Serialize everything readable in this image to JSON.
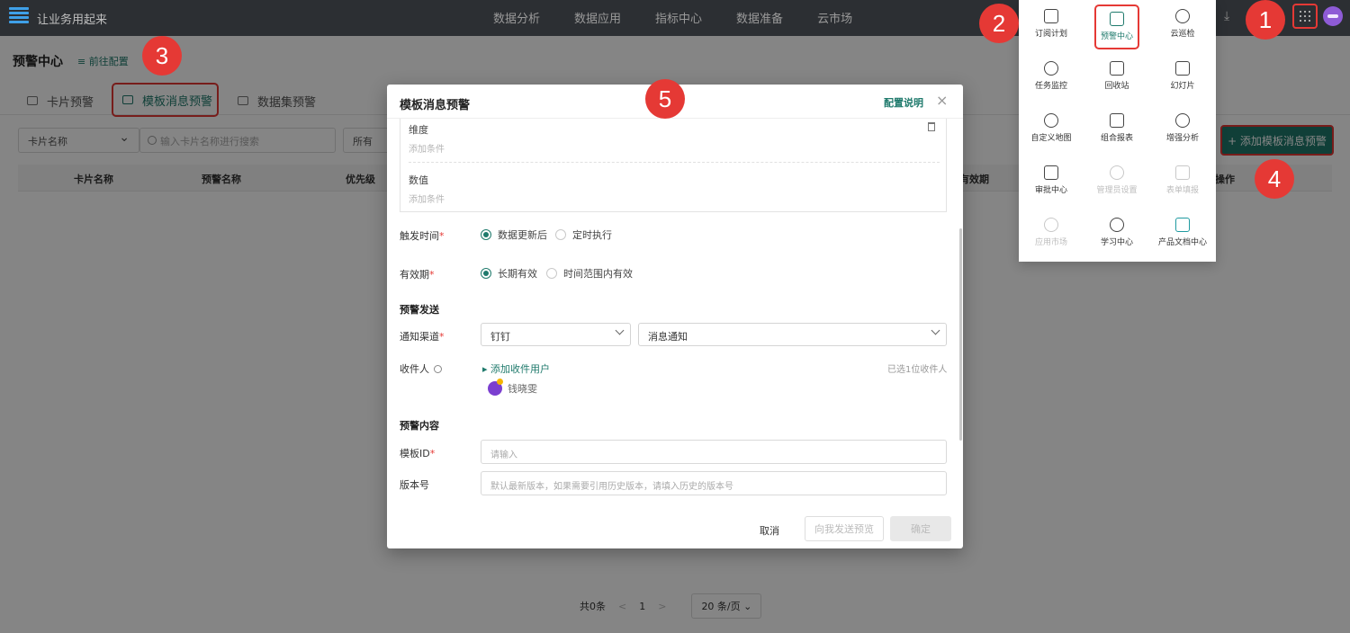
{
  "topbar": {
    "brand": "让业务用起来",
    "nav": [
      "数据分析",
      "数据应用",
      "指标中心",
      "数据准备",
      "云市场"
    ]
  },
  "page": {
    "title": "预警中心",
    "goto_config": "≡ 前往配置",
    "tabs": [
      "卡片预警",
      "模板消息预警",
      "数据集预警"
    ],
    "filter": {
      "card_select": "卡片名称",
      "search_placeholder": "输入卡片名称进行搜索",
      "status_select": "所有"
    },
    "add_button": "+ 添加模板消息预警",
    "table_headers": [
      "卡片名称",
      "预警名称",
      "优先级",
      "有效期",
      "操作"
    ],
    "pagination": {
      "total": "共0条",
      "prev": "<",
      "page": "1",
      "next": ">",
      "page_size": "20 条/页 ⌄"
    }
  },
  "apps_menu": {
    "items": [
      {
        "label": "订阅计划",
        "icon": "calendar-clock-icon",
        "state": "normal"
      },
      {
        "label": "预警中心",
        "icon": "alert-bell-icon",
        "state": "highlight"
      },
      {
        "label": "云巡检",
        "icon": "cloud-inspect-icon",
        "state": "normal"
      },
      {
        "label": "任务监控",
        "icon": "gauge-icon",
        "state": "normal"
      },
      {
        "label": "回收站",
        "icon": "trash-icon",
        "state": "normal"
      },
      {
        "label": "幻灯片",
        "icon": "slides-icon",
        "state": "normal"
      },
      {
        "label": "自定义地图",
        "icon": "map-pin-icon",
        "state": "normal"
      },
      {
        "label": "组合报表",
        "icon": "clipboard-report-icon",
        "state": "normal"
      },
      {
        "label": "增强分析",
        "icon": "analysis-icon",
        "state": "normal"
      },
      {
        "label": "审批中心",
        "icon": "approval-doc-icon",
        "state": "normal"
      },
      {
        "label": "管理员设置",
        "icon": "gear-icon",
        "state": "disabled"
      },
      {
        "label": "表单填报",
        "icon": "form-edit-icon",
        "state": "disabled"
      },
      {
        "label": "应用市场",
        "icon": "cloud-market-icon",
        "state": "disabled"
      },
      {
        "label": "学习中心",
        "icon": "learner-icon",
        "state": "normal"
      },
      {
        "label": "产品文档中心",
        "icon": "chart-doc-icon",
        "state": "normal"
      }
    ]
  },
  "badges": [
    "1",
    "2",
    "3",
    "4",
    "5"
  ],
  "modal": {
    "title": "模板消息预警",
    "config_link": "配置说明",
    "close": "×",
    "dimension_label": "维度",
    "dimension_add": "添加条件",
    "value_label": "数值",
    "value_add": "添加条件",
    "trigger_label": "触发时间",
    "trigger_options": [
      "数据更新后",
      "定时执行"
    ],
    "validity_label": "有效期",
    "validity_options": [
      "长期有效",
      "时间范围内有效"
    ],
    "send_section": "预警发送",
    "channel_label": "通知渠道",
    "channel_value": "钉钉",
    "channel_type": "消息通知",
    "recipient_label": "收件人",
    "add_recipient": "▸ 添加收件用户",
    "selected_count": "已选1位收件人",
    "recipient_name": "钱晓雯",
    "content_section": "预警内容",
    "template_id_label": "模板ID",
    "template_id_placeholder": "请输入",
    "version_label": "版本号",
    "version_placeholder": "默认最新版本，如果需要引用历史版本，请填入历史的版本号",
    "cancel": "取消",
    "send_to_me": "向我发送预览",
    "confirm": "确定",
    "required_mark": "*"
  }
}
